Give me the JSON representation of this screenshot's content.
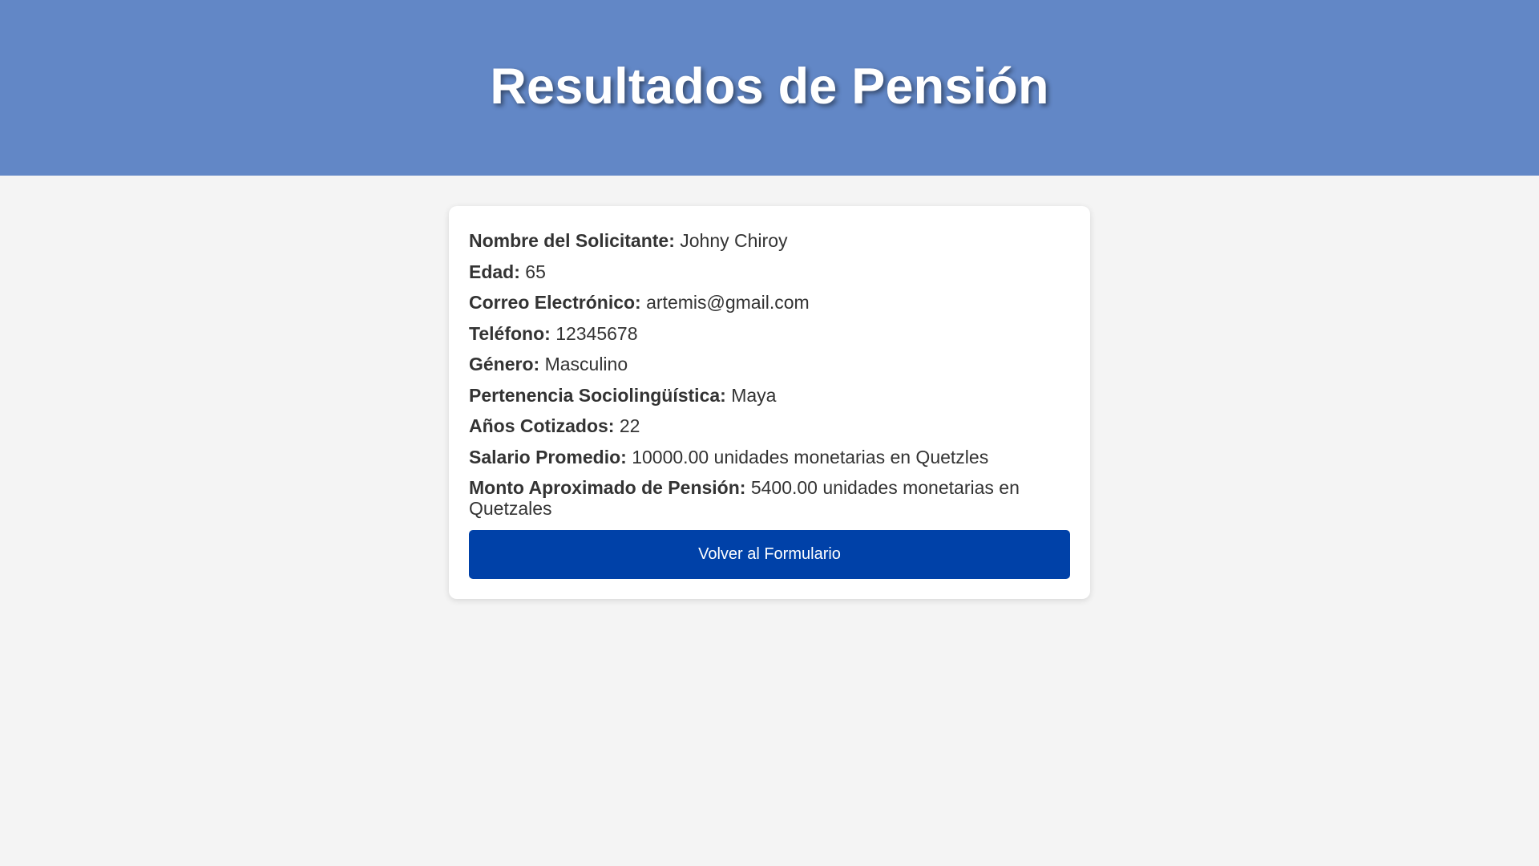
{
  "header": {
    "title": "Resultados de Pensión"
  },
  "results": [
    {
      "label": "Nombre del Solicitante:",
      "value": "Johny Chiroy"
    },
    {
      "label": "Edad:",
      "value": "65"
    },
    {
      "label": "Correo Electrónico:",
      "value": "artemis@gmail.com"
    },
    {
      "label": "Teléfono:",
      "value": "12345678"
    },
    {
      "label": "Género:",
      "value": "Masculino"
    },
    {
      "label": "Pertenencia Sociolingüística:",
      "value": "Maya"
    },
    {
      "label": "Años Cotizados:",
      "value": "22"
    },
    {
      "label": "Salario Promedio:",
      "value": "10000.00 unidades monetarias en Quetzles"
    },
    {
      "label": "Monto Aproximado de Pensión:",
      "value": "5400.00 unidades monetarias en Quetzales"
    }
  ],
  "actions": {
    "back_label": "Volver al Formulario"
  },
  "colors": {
    "header_bg": "#6287c6",
    "button_bg": "#0041a8",
    "page_bg": "#f4f4f4"
  }
}
